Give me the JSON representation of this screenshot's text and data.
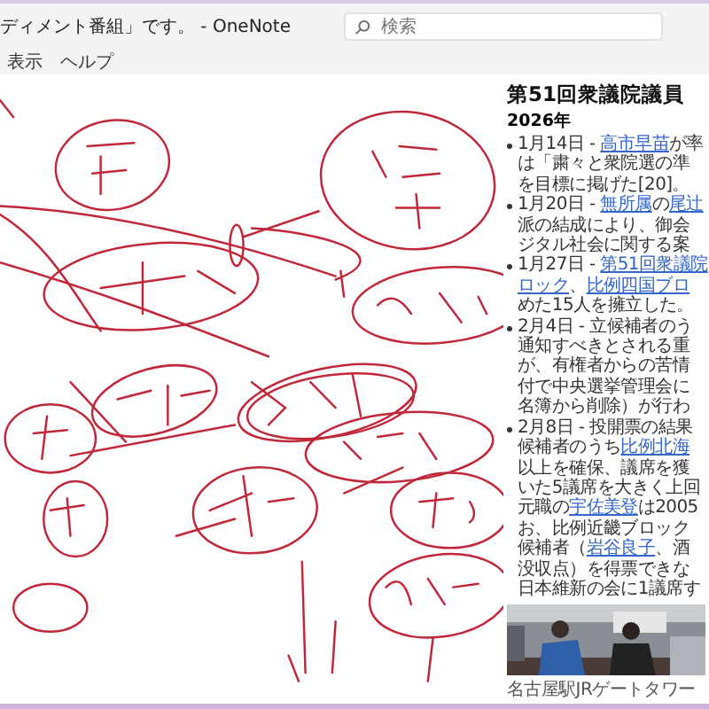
{
  "window": {
    "title": "ディメント番組」です。 - OneNote"
  },
  "search": {
    "placeholder": "検索"
  },
  "menu": [
    {
      "label": "表示"
    },
    {
      "label": "ヘルプ"
    }
  ],
  "article": {
    "heading": "第51回衆議院議員",
    "subheading": "2026年",
    "items": [
      {
        "lines": [
          [
            {
              "text": "1月14日 - ",
              "link": false
            },
            {
              "text": "高市早苗",
              "link": true
            },
            {
              "text": "が率",
              "link": false
            }
          ],
          [
            {
              "text": "は「粛々と衆院選の準",
              "link": false
            }
          ],
          [
            {
              "text": "を目標に掲げた[20]。",
              "link": false
            }
          ]
        ]
      },
      {
        "lines": [
          [
            {
              "text": "1月20日 - ",
              "link": false
            },
            {
              "text": "無所属",
              "link": true
            },
            {
              "text": "の",
              "link": false
            },
            {
              "text": "尾辻",
              "link": true
            }
          ],
          [
            {
              "text": "派の結成により、御会",
              "link": false
            }
          ],
          [
            {
              "text": "ジタル社会に関する案",
              "link": false
            }
          ]
        ]
      },
      {
        "lines": [
          [
            {
              "text": "1月27日 - ",
              "link": false
            },
            {
              "text": "第51回衆議院",
              "link": true
            }
          ],
          [
            {
              "text": "ロック",
              "link": true
            },
            {
              "text": "、",
              "link": false
            },
            {
              "text": "比例四国ブロ",
              "link": true
            }
          ],
          [
            {
              "text": "めた15人を擁立した。",
              "link": false
            }
          ]
        ]
      },
      {
        "lines": [
          [
            {
              "text": "2月4日 - 立候補者のう",
              "link": false
            }
          ],
          [
            {
              "text": "通知すべきとされる重",
              "link": false
            }
          ],
          [
            {
              "text": "が、有権者からの苦情",
              "link": false
            }
          ],
          [
            {
              "text": "付で中央選挙管理会に",
              "link": false
            }
          ],
          [
            {
              "text": "名簿から削除）が行わ",
              "link": false
            }
          ]
        ]
      },
      {
        "lines": [
          [
            {
              "text": "2月8日 - 投開票の結果",
              "link": false
            }
          ],
          [
            {
              "text": "候補者のうち",
              "link": false
            },
            {
              "text": "比例北海",
              "link": true
            }
          ],
          [
            {
              "text": "以上を確保、議席を獲",
              "link": false
            }
          ],
          [
            {
              "text": "いた5議席を大きく上回",
              "link": false
            }
          ],
          [
            {
              "text": "元職の",
              "link": false
            },
            {
              "text": "宇佐美登",
              "link": true
            },
            {
              "text": "は2005",
              "link": false
            }
          ],
          [
            {
              "text": "お、比例近畿ブロック",
              "link": false
            }
          ],
          [
            {
              "text": "候補者（",
              "link": false
            },
            {
              "text": "岩谷良子",
              "link": true
            },
            {
              "text": "、酒",
              "link": false
            }
          ],
          [
            {
              "text": "没収点）を得票できな",
              "link": false
            }
          ],
          [
            {
              "text": "日本維新の会に1議席す",
              "link": false
            }
          ]
        ]
      }
    ],
    "photo": {
      "kind": "picture",
      "caption": "名古屋駅JRゲートタワー"
    }
  }
}
